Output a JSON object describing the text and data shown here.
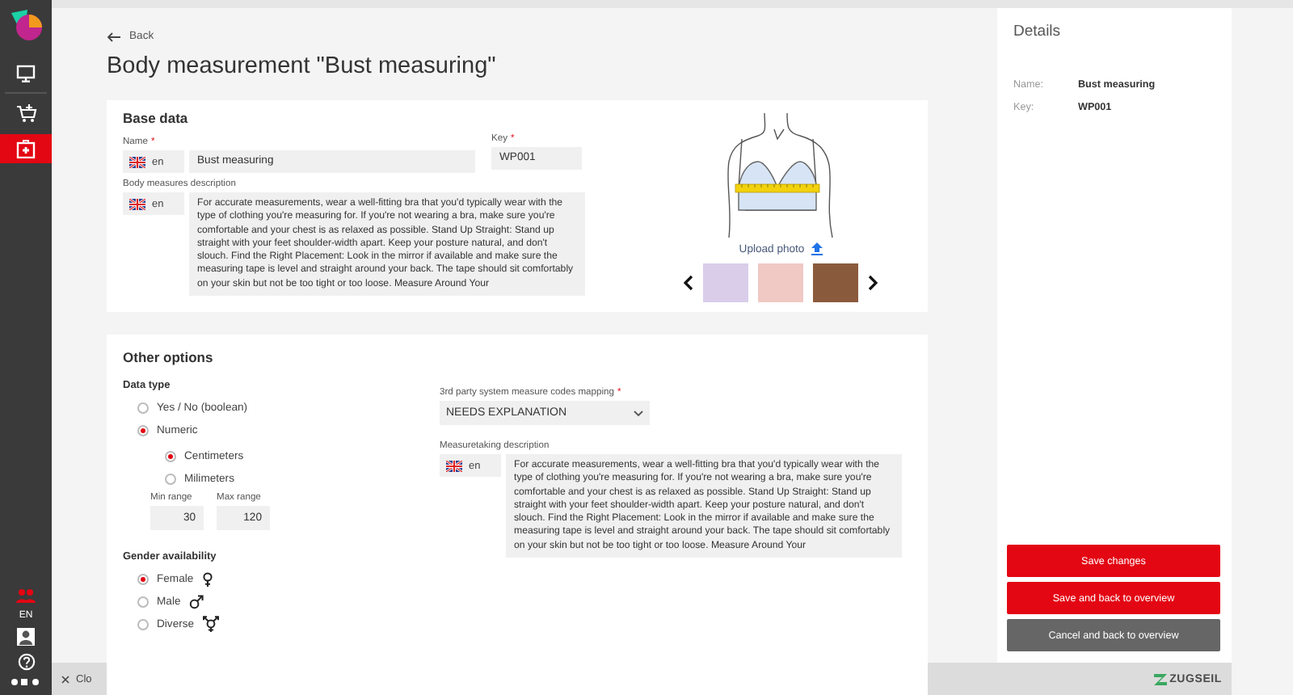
{
  "sidebar": {
    "items": [
      {
        "kind": "monitor",
        "selected": false
      },
      {
        "kind": "cart",
        "selected": false
      },
      {
        "kind": "medical",
        "selected": true
      }
    ],
    "language": "EN"
  },
  "back": "Back",
  "title": "Body measurement \"Bust measuring\"",
  "base_data": {
    "heading": "Base data",
    "name": {
      "label": "Name",
      "required_mark": "*",
      "language": "en",
      "value": "Bust measuring"
    },
    "key": {
      "label": "Key",
      "required_mark": "*",
      "value": "WP001"
    },
    "description": {
      "label": "Body measures description",
      "language": "en",
      "value": "For accurate measurements, wear a well-fitting bra that you'd typically wear with the type of clothing you're measuring for. If you're not wearing a bra, make sure you're comfortable and your chest is as relaxed as possible. Stand Up Straight: Stand up straight with your feet shoulder-width apart. Keep your posture natural, and don't slouch. Find the Right Placement: Look in the mirror if available and make sure the measuring tape is level and straight around your back. The tape should sit comfortably on your skin but not be too tight or too loose. Measure Around Your"
    },
    "upload": "Upload photo"
  },
  "other_options": {
    "heading": "Other options",
    "data_type": {
      "label": "Data type",
      "options": [
        {
          "label": "Yes / No (boolean)",
          "selected": false
        },
        {
          "label": "Numeric",
          "selected": true
        }
      ],
      "units": [
        {
          "label": "Centimeters",
          "selected": true
        },
        {
          "label": "Milimeters",
          "selected": false
        }
      ],
      "min_range": {
        "label": "Min range",
        "value": "30"
      },
      "max_range": {
        "label": "Max range",
        "value": "120"
      }
    },
    "gender": {
      "label": "Gender availability",
      "options": [
        {
          "label": "Female",
          "kind": "female",
          "selected": true
        },
        {
          "label": "Male",
          "kind": "male",
          "selected": false
        },
        {
          "label": "Diverse",
          "kind": "diverse",
          "selected": false
        }
      ]
    },
    "mapping": {
      "label": "3rd party system measure codes mapping",
      "required_mark": "*",
      "value": "NEEDS EXPLANATION"
    },
    "measuretaking": {
      "label": "Measuretaking description",
      "language": "en",
      "value": "For accurate measurements, wear a well-fitting bra that you'd typically wear with the type of clothing you're measuring for. If you're not wearing a bra, make sure you're comfortable and your chest is as relaxed as possible. Stand Up Straight: Stand up straight with your feet shoulder-width apart. Keep your posture natural, and don't slouch. Find the Right Placement: Look in the mirror if available and make sure the measuring tape is level and straight around your back. The tape should sit comfortably on your skin but not be too tight or too loose. Measure Around Your"
    }
  },
  "details": {
    "title": "Details",
    "fields": [
      {
        "label": "Name:",
        "value": "Bust measuring"
      },
      {
        "label": "Key:",
        "value": "WP001"
      }
    ],
    "buttons": [
      {
        "label": "Save changes",
        "kind": "primary"
      },
      {
        "label": "Save and back to overview",
        "kind": "primary"
      },
      {
        "label": "Cancel and back to overview",
        "kind": "secondary"
      }
    ]
  },
  "footer": {
    "close": "Clo",
    "brand": "ZUGSEIL"
  }
}
